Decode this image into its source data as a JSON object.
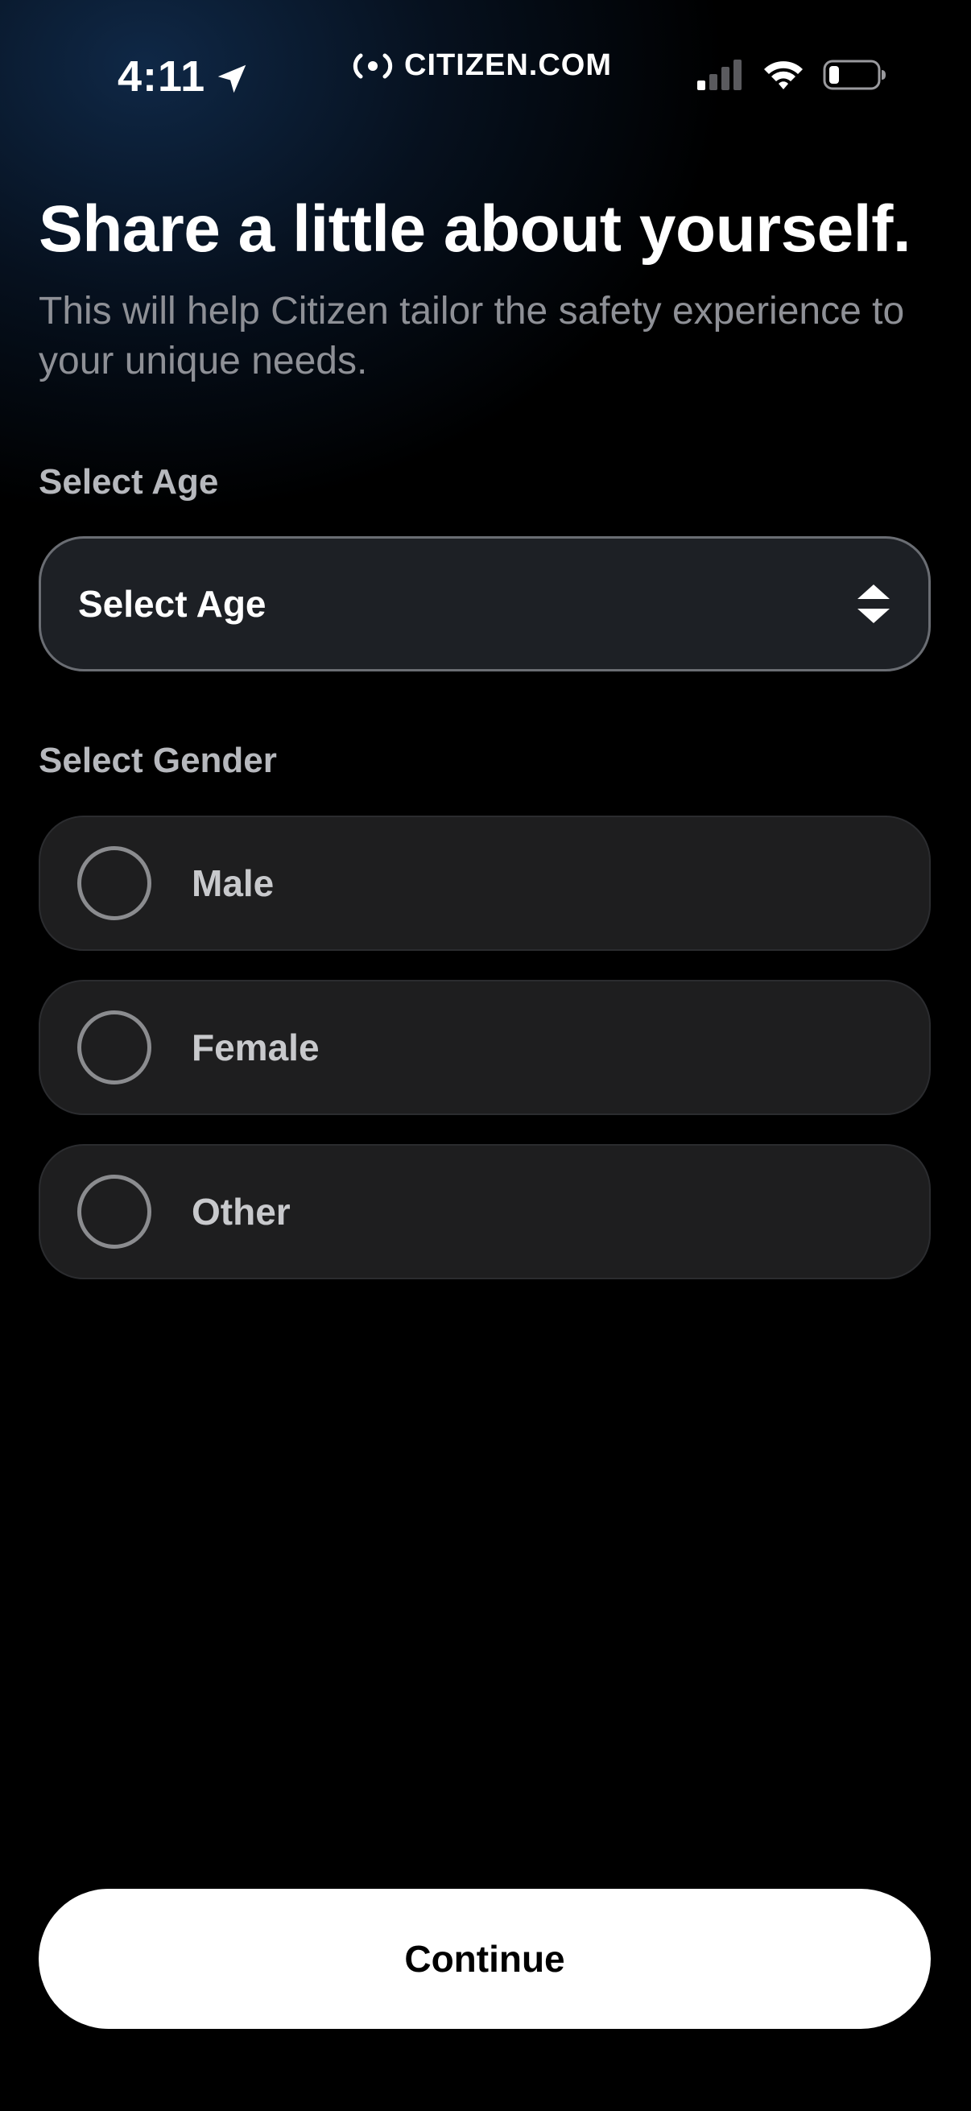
{
  "status_bar": {
    "time": "4:11",
    "location_icon": "location-arrow-icon",
    "brand_text": "CITIZEN.COM",
    "brand_icon": "citizen-signal-icon",
    "signal_icon": "cellular-signal-icon",
    "wifi_icon": "wifi-icon",
    "battery_icon": "battery-low-icon"
  },
  "header": {
    "title": "Share a little about yourself.",
    "subtitle": "This will help Citizen tailor the safety experience to your unique needs."
  },
  "age": {
    "section_label": "Select Age",
    "select_value": "Select Age",
    "icon": "chevron-up-down-icon"
  },
  "gender": {
    "section_label": "Select Gender",
    "options": [
      {
        "label": "Male",
        "selected": false
      },
      {
        "label": "Female",
        "selected": false
      },
      {
        "label": "Other",
        "selected": false
      }
    ]
  },
  "footer": {
    "continue_label": "Continue"
  },
  "colors": {
    "background": "#000000",
    "gradient_blue": "#102a4a",
    "card": "#1e1e1f",
    "subtitle": "#8e9096",
    "button": "#ffffff"
  }
}
